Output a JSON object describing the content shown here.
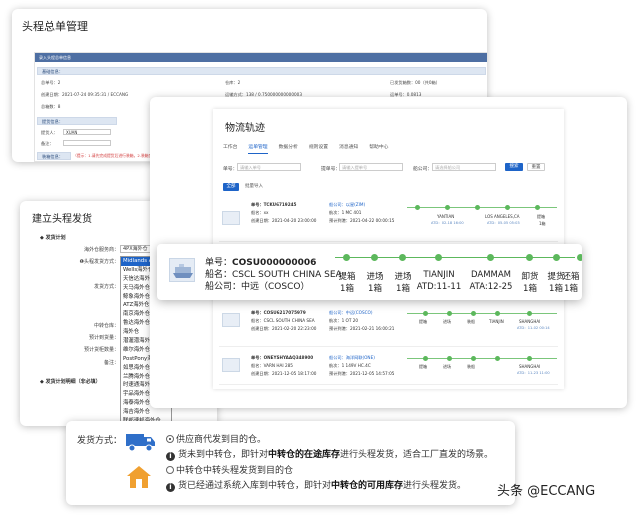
{
  "card1": {
    "title": "头程总单管理",
    "form_header": "录入头程总单信息",
    "section_basic": "基础信息：",
    "fields": [
      {
        "k": "总单号：",
        "v": "2"
      },
      {
        "k": "仓库：",
        "v": "2"
      },
      {
        "k": "已发货箱数：",
        "v": "00（共0箱）"
      },
      {
        "k": "创建日期：",
        "v": "2021-07-24 09:35:31 / ECCANG"
      },
      {
        "k": "运输方式：",
        "v": "138 / 0.750000000000003"
      },
      {
        "k": "运单号：",
        "v": "0.0813"
      },
      {
        "k": "总箱数：",
        "v": "8"
      }
    ],
    "section_shipping": "提货信息：",
    "input_labels": [
      "提货人：",
      "备注："
    ],
    "input_values": [
      "XUAN",
      ""
    ],
    "section_status": "装箱信息：",
    "warning": "（提示：1.请先完成提货后进行装箱，2.装箱完成后才可以提交审核）"
  },
  "card2": {
    "title": "建立头程发货",
    "section_plan": "发货计划",
    "labels": [
      "海外仓服务商：",
      "头程发货方式：",
      "发货方式：",
      "中转仓库：",
      "预计到货量：",
      "预计货柜数量：",
      "备注："
    ],
    "combo_value": "4PX海外仓",
    "dropdown_options": [
      "Midlands Associat",
      "Wells海外仓",
      "天信达海外仓",
      "天马海外仓",
      "鲸象海外仓",
      "ATZ海外仓",
      "南京海外仓",
      "鲁达海外仓",
      "海外仓",
      "潜渥潜海外仓",
      "维尔海外仓",
      "PostPony海外仓",
      "如思海外仓",
      "兰腾海外仓",
      "时速通海外仓",
      "宇品海外仓",
      "海泰海外仓",
      "海吉海外仓",
      "联邦速邦海外仓",
      "新航标海外仓",
      "海外仓"
    ],
    "section_detail": "发货计划明细（非必填）"
  },
  "card3": {
    "title": "物流轨迹",
    "tabs": [
      "工作台",
      "运单管理",
      "数据分析",
      "规则设置",
      "消息通知",
      "帮助中心"
    ],
    "filters": [
      {
        "label": "单号：",
        "placeholder": "请输入单号"
      },
      {
        "label": "提单号：",
        "placeholder": "请输入提单号"
      },
      {
        "label": "船公司：",
        "placeholder": "请选择船公司"
      }
    ],
    "search_btn": "搜索",
    "reset_btn": "重置",
    "list_tabs": [
      "全部",
      "批量导入"
    ],
    "rows": [
      {
        "no": "单号：TCKU6719245",
        "ship": "船名：xx",
        "company": "船公司：以星(ZIM)",
        "date": "创建日期：2021-04-20 23:00:00",
        "voyage": "航次：1 MC 401",
        "eta": "预计到港：2021-04-22 00:00:15",
        "p1": "YANTIAN",
        "p1t": "ATD：02-18 16:00",
        "p2": "LOS ANGELES,CA",
        "p2t": "ATD：05-05 05:03",
        "p3": "提箱",
        "p3t": "1箱"
      },
      {
        "no": "单号：COSU6217075979",
        "ship": "船名：CSCL SOUTH CHINA SEA",
        "company": "船公司：中远(COSCO)",
        "date": "创建日期：2021-02-20 22:23:00",
        "voyage": "航次：1 OT 20",
        "eta": "预计到港：2021-02-21 16:00:21",
        "p1": "提箱",
        "p1t": "",
        "p2": "进场",
        "p2t": "",
        "p3": "SHANGHAI",
        "p3t": "ATD：11-02 00:14"
      },
      {
        "no": "单号：ONEYSHYAAQ348900",
        "ship": "船名：VARN HAI 285",
        "company": "船公司：海洋网联(ONE)",
        "date": "创建日期：2021-12-05 18:17:00",
        "voyage": "航次：1 149V HC.4C",
        "eta": "预计到港：2021-12-05 14:57:05",
        "p1": "提箱",
        "p1t": "",
        "p2": "进场",
        "p2t": "",
        "p3": "SHANGHAI",
        "p3t": "ATD：11-23 11:00"
      }
    ],
    "row2_extra": [
      "提箱",
      "进场",
      "装船",
      "TIANJIN"
    ],
    "row3_extra": [
      "提箱",
      "进场",
      "装船"
    ],
    "row1_extra": [
      "进场",
      "装船"
    ]
  },
  "popup": {
    "no_label": "单号：",
    "no_value": "COSU000000006",
    "ship_label": "船名：",
    "ship_value": "CSCL SOUTH CHINA SEA",
    "company_label": "船公司：",
    "company_value": "中远（COSCO）",
    "stages": [
      {
        "name": "提箱",
        "sub": "1箱"
      },
      {
        "name": "进场",
        "sub": "1箱"
      },
      {
        "name": "进场",
        "sub": "1箱"
      },
      {
        "name": "TIANJIN",
        "sub": "ATD:11-11"
      },
      {
        "name": "DAMMAM",
        "sub": "ATA:12-25"
      },
      {
        "name": "卸货",
        "sub": "1箱"
      },
      {
        "name": "提货",
        "sub": "1箱"
      },
      {
        "name": "还箱",
        "sub": "1箱"
      }
    ]
  },
  "bottom": {
    "label": "发货方式：",
    "opt1": "供应商代发到目的仓。",
    "opt1_desc_a": "货未到中转仓，即针对",
    "opt1_desc_b": "中转仓的在途库存",
    "opt1_desc_c": "进行头程发货，适合工厂直发的场景。",
    "opt2": "中转仓中转头程发货到目的仓",
    "opt2_desc_a": "货已经通过系统入库到中转仓，即针对",
    "opt2_desc_b": "中转仓的可用库存",
    "opt2_desc_c": "进行头程发货。"
  },
  "watermark": "头条 @ECCANG",
  "colors": {
    "accent": "#1e64c8",
    "success": "#5cb85c",
    "header": "#4e6fa3",
    "warn": "#d23b3b",
    "truck": "#2f6fc9",
    "house": "#f0a030"
  }
}
